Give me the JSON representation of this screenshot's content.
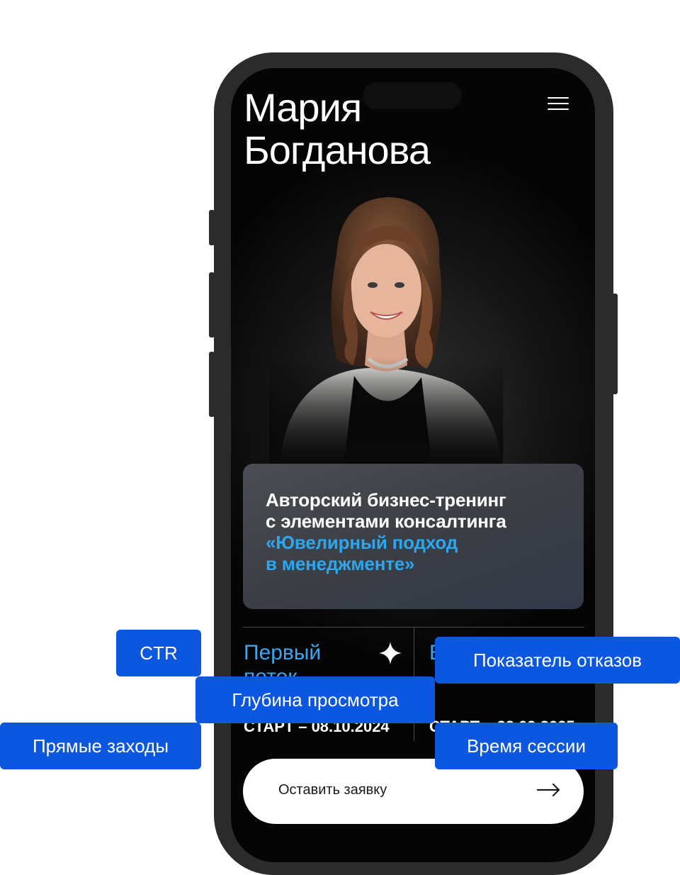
{
  "profile": {
    "first_name": "Мария",
    "last_name": "Богданова"
  },
  "header": {
    "menu_icon": "hamburger-menu-icon"
  },
  "promo": {
    "line1": "Авторский бизнес-тренинг",
    "line2": "с элементами консалтинга",
    "accent_line1": "«Ювелирный подход",
    "accent_line2": "в менеджменте»",
    "accent_color": "#2aa7f0"
  },
  "streams": [
    {
      "title_line1": "Первый",
      "title_line2": "поток",
      "icon": "sparkle-icon",
      "start": "СТАРТ – 08.10.2024"
    },
    {
      "title_line1": "В",
      "start": "СТАРТ – 22.09.2025"
    }
  ],
  "cta": {
    "label": "Оставить заявку",
    "icon": "arrow-right-icon"
  },
  "metric_tags": {
    "ctr": "CTR",
    "bounce_rate": "Показатель отказов",
    "view_depth": "Глубина просмотра",
    "direct_visits": "Прямые заходы",
    "session_time": "Время сессии",
    "color": "#0b57e0"
  }
}
